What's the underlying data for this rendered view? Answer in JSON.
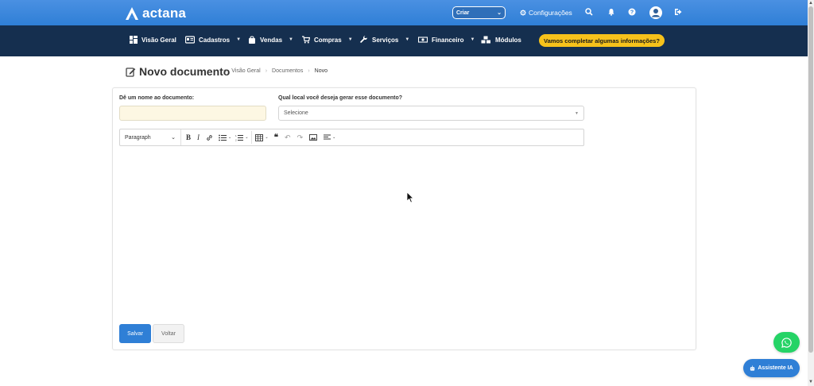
{
  "topbar": {
    "brand": "actana",
    "criar_label": "Criar",
    "config_label": "Configurações"
  },
  "nav": {
    "items": [
      {
        "label": "Visão Geral",
        "icon": "dashboard-icon"
      },
      {
        "label": "Cadastros",
        "icon": "id-card-icon"
      },
      {
        "label": "Vendas",
        "icon": "shopping-bag-icon"
      },
      {
        "label": "Compras",
        "icon": "cart-icon"
      },
      {
        "label": "Serviços",
        "icon": "wrench-icon"
      },
      {
        "label": "Financeiro",
        "icon": "money-icon"
      },
      {
        "label": "Módulos",
        "icon": "cubes-icon"
      }
    ],
    "cta_label": "Vamos completar algumas informações?"
  },
  "page": {
    "title": "Novo documento",
    "breadcrumb": [
      "Visão Geral",
      "Documentos",
      "Novo"
    ]
  },
  "form": {
    "name_label": "Dê um nome ao documento:",
    "name_value": "",
    "local_label": "Qual local você deseja gerar esse documento?",
    "local_value": "Selecione",
    "paragraph_style": "Paragraph",
    "save_label": "Salvar",
    "back_label": "Voltar"
  },
  "assistant_label": "Assistente IA"
}
